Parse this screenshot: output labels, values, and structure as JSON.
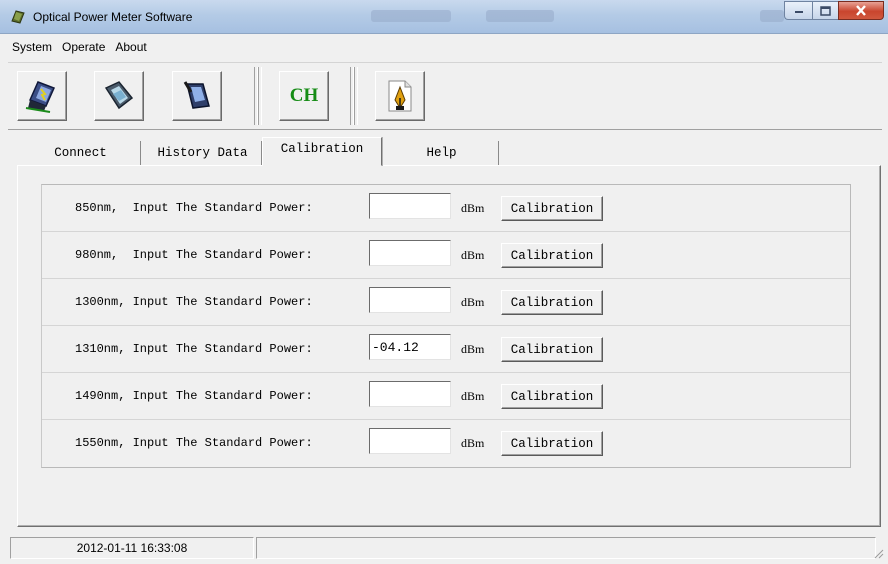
{
  "window": {
    "title": "Optical Power Meter Software"
  },
  "menu": [
    "System",
    "Operate",
    "About"
  ],
  "toolbar": {
    "ch_label": "CH",
    "buttons": [
      "connect-device-icon",
      "monitor-icon",
      "device-probe-icon",
      "ch-channel",
      "report-pen-icon"
    ]
  },
  "tabs": [
    {
      "label": "Connect",
      "active": false
    },
    {
      "label": "History Data",
      "active": false
    },
    {
      "label": "Calibration",
      "active": true
    },
    {
      "label": "Help",
      "active": false
    }
  ],
  "calibration": {
    "rows": [
      {
        "label": "850nm,  Input The Standard Power:",
        "value": "",
        "unit": "dBm",
        "button": "Calibration"
      },
      {
        "label": "980nm,  Input The Standard Power:",
        "value": "",
        "unit": "dBm",
        "button": "Calibration"
      },
      {
        "label": "1300nm, Input The Standard Power:",
        "value": "",
        "unit": "dBm",
        "button": "Calibration"
      },
      {
        "label": "1310nm, Input The Standard Power:",
        "value": "-04.12",
        "unit": "dBm",
        "button": "Calibration"
      },
      {
        "label": "1490nm, Input The Standard Power:",
        "value": "",
        "unit": "dBm",
        "button": "Calibration"
      },
      {
        "label": "1550nm, Input The Standard Power:",
        "value": "",
        "unit": "dBm",
        "button": "Calibration"
      }
    ]
  },
  "status": {
    "datetime": "2012-01-11 16:33:08",
    "secondary": ""
  },
  "colors": {
    "ch_text": "#168c16",
    "title_bar": "#b4cbe6",
    "close_button": "#c9452e"
  }
}
